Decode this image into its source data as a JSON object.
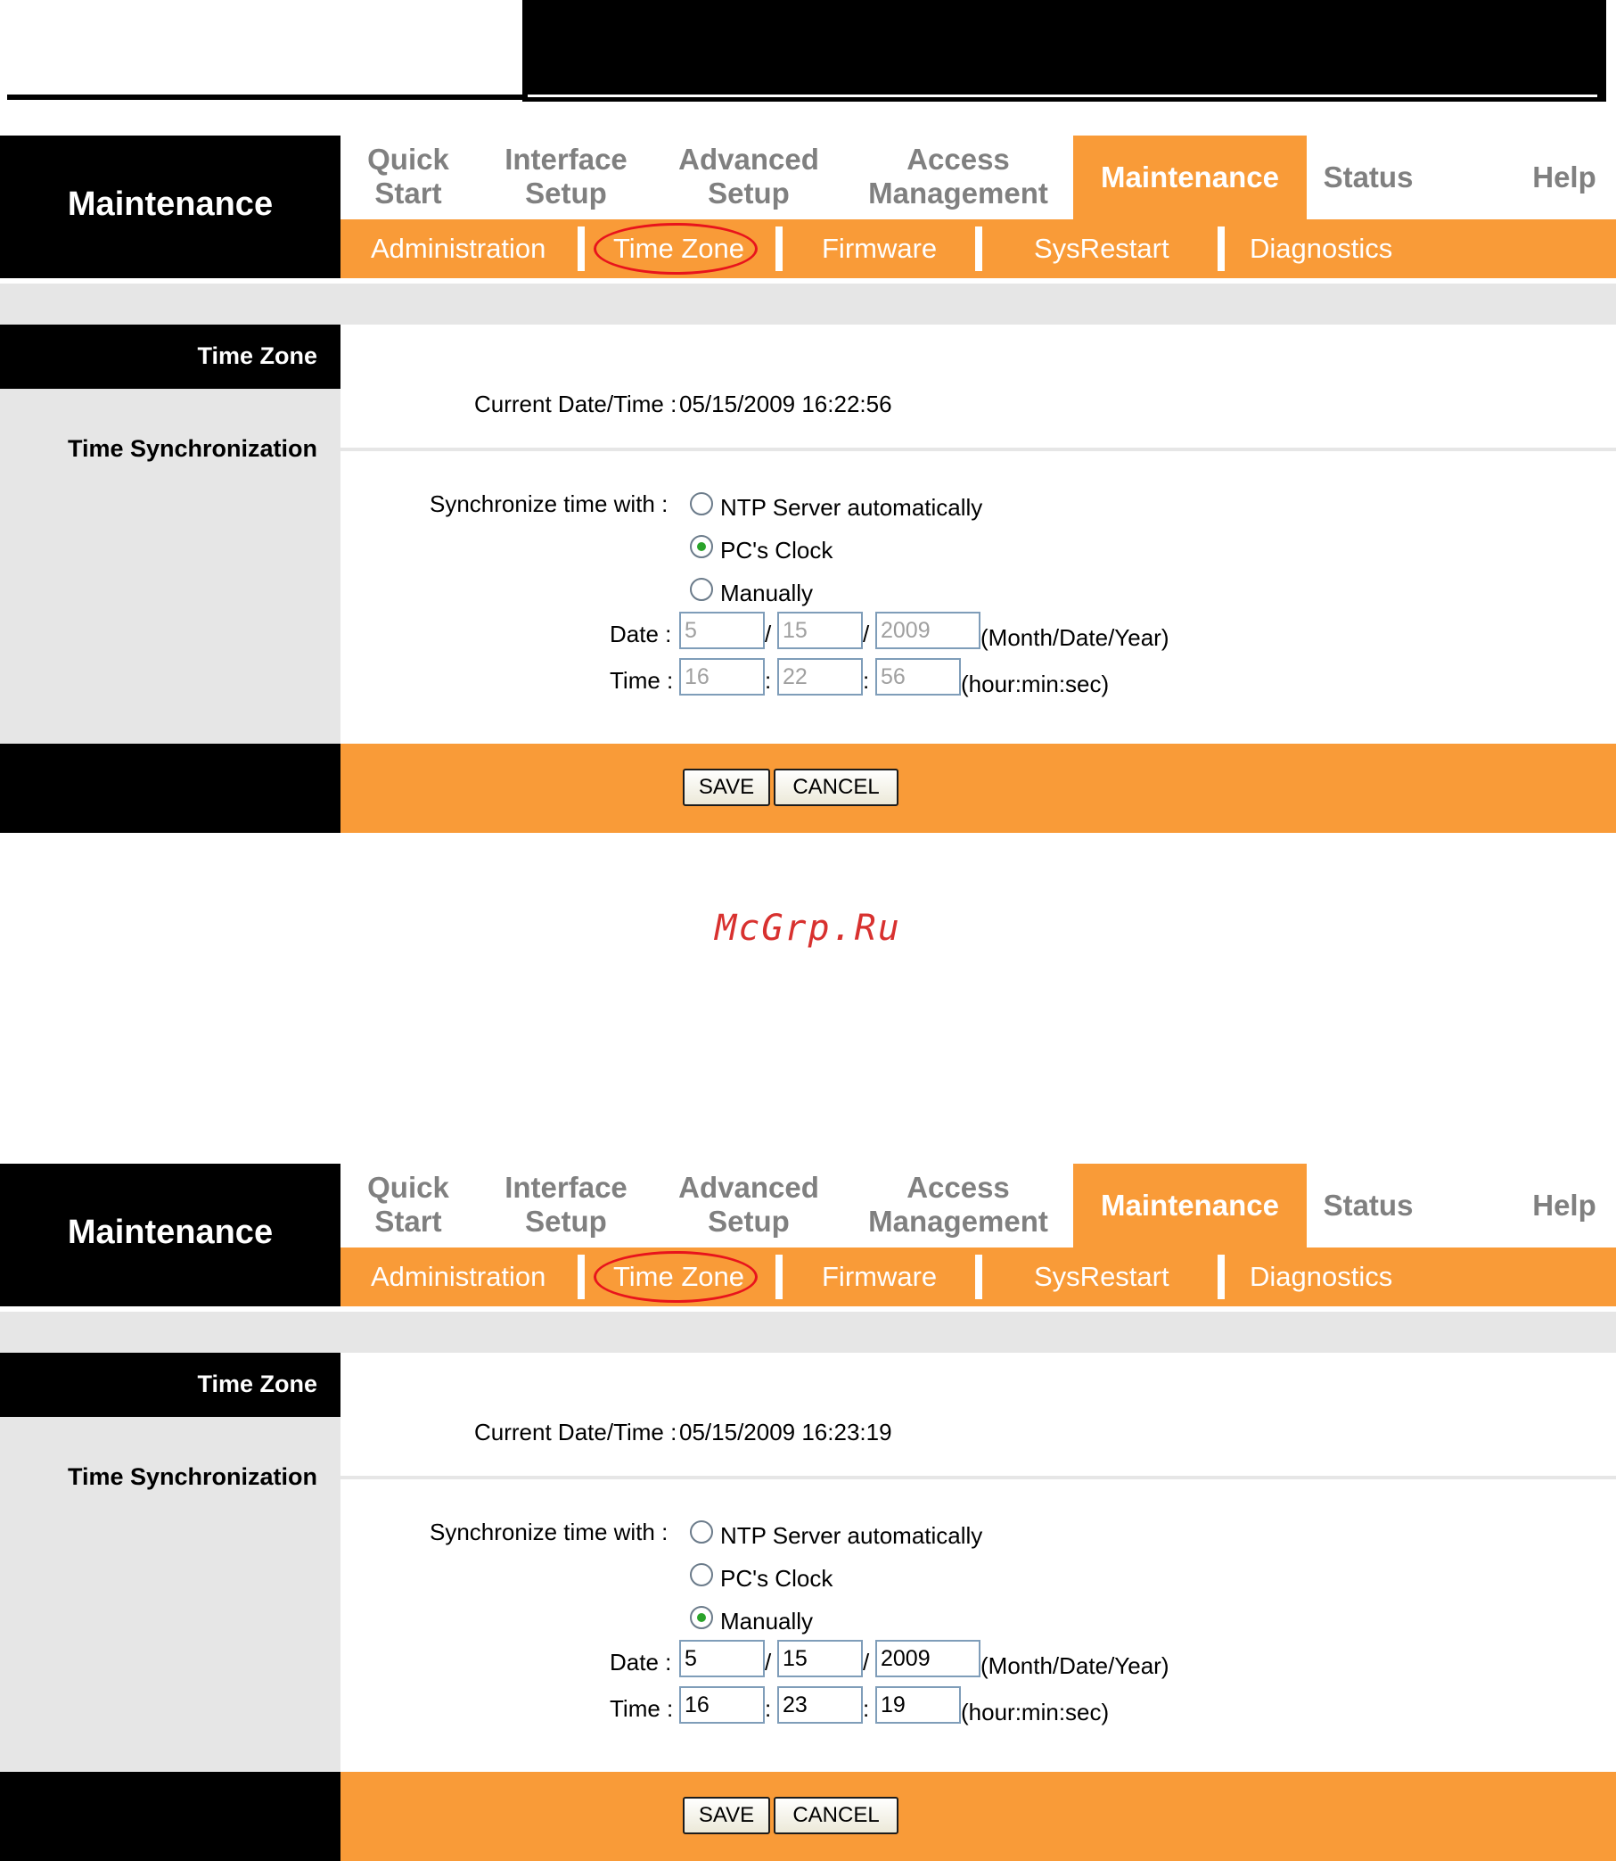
{
  "app": {
    "title": "Maintenance"
  },
  "menu": {
    "items": [
      {
        "label": "Quick Start"
      },
      {
        "label": "Interface Setup"
      },
      {
        "label": "Advanced Setup"
      },
      {
        "label": "Access Management"
      },
      {
        "label": "Maintenance",
        "active": true
      },
      {
        "label": "Status"
      },
      {
        "label": "Help"
      }
    ]
  },
  "submenu": {
    "items": [
      {
        "label": "Administration"
      },
      {
        "label": "Time Zone",
        "highlighted": true
      },
      {
        "label": "Firmware"
      },
      {
        "label": "SysRestart"
      },
      {
        "label": "Diagnostics"
      }
    ]
  },
  "sections": {
    "time_zone": "Time Zone",
    "time_sync": "Time Synchronization"
  },
  "labels": {
    "current_datetime": "Current Date/Time :",
    "sync_with": "Synchronize time with :",
    "date": "Date :",
    "time": "Time :",
    "date_format": "(Month/Date/Year)",
    "time_format": "(hour:min:sec)",
    "date_sep": "/",
    "time_sep": ":"
  },
  "radio_options": [
    "NTP Server automatically",
    "PC's Clock",
    "Manually"
  ],
  "buttons": {
    "save": "SAVE",
    "cancel": "CANCEL"
  },
  "panels": [
    {
      "current_datetime": "05/15/2009 16:22:56",
      "selected": "PC's Clock",
      "fields_enabled": false,
      "date": {
        "month": "5",
        "day": "15",
        "year": "2009"
      },
      "time": {
        "hour": "16",
        "min": "22",
        "sec": "56"
      }
    },
    {
      "current_datetime": "05/15/2009 16:23:19",
      "selected": "Manually",
      "fields_enabled": true,
      "date": {
        "month": "5",
        "day": "15",
        "year": "2009"
      },
      "time": {
        "hour": "16",
        "min": "23",
        "sec": "19"
      }
    }
  ],
  "watermark": "McGrp.Ru",
  "colors": {
    "accent": "#f99b38",
    "highlight_circle": "#e8141c",
    "watermark": "#d8312f"
  }
}
